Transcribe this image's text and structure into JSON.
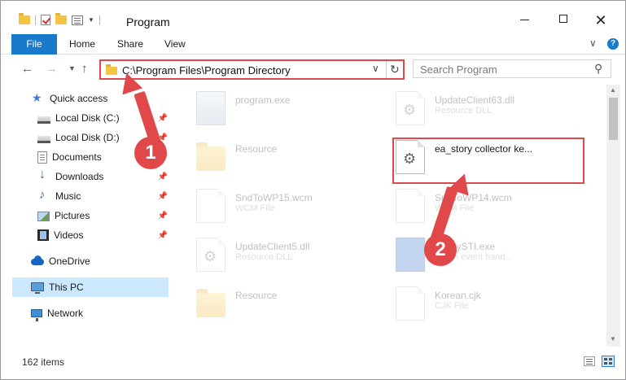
{
  "window": {
    "title": "Program",
    "controls": {
      "minimize": "minimize",
      "maximize": "maximize",
      "close": "✕"
    }
  },
  "ribbon": {
    "tabs": [
      "File",
      "Home",
      "Share",
      "View"
    ],
    "active_tab": "File",
    "accent": "#1979ca"
  },
  "address": {
    "path": "C:\\Program Files\\Program Directory",
    "search_placeholder": "Search Program"
  },
  "sidebar": {
    "items": [
      {
        "label": "Quick access",
        "icon": "star-icon",
        "pinned": false
      },
      {
        "label": "Local Disk (C:)",
        "icon": "drive-icon",
        "pinned": true
      },
      {
        "label": "Local Disk (D:)",
        "icon": "drive-icon",
        "pinned": true
      },
      {
        "label": "Documents",
        "icon": "documents-icon",
        "pinned": true
      },
      {
        "label": "Downloads",
        "icon": "download-icon",
        "pinned": true
      },
      {
        "label": "Music",
        "icon": "music-icon",
        "pinned": true
      },
      {
        "label": "Pictures",
        "icon": "pictures-icon",
        "pinned": true
      },
      {
        "label": "Videos",
        "icon": "videos-icon",
        "pinned": true
      },
      {
        "label": "OneDrive",
        "icon": "cloud-icon",
        "pinned": false
      },
      {
        "label": "This PC",
        "icon": "computer-icon",
        "pinned": false,
        "selected": true
      },
      {
        "label": "Network",
        "icon": "network-icon",
        "pinned": false
      }
    ]
  },
  "files": [
    {
      "name": "program.exe",
      "type": "",
      "icon": "exe-icon",
      "faded": true
    },
    {
      "name": "UpdateClient63.dll",
      "type": "Resource DLL",
      "icon": "dll-icon",
      "faded": true
    },
    {
      "name": "Resource",
      "type": "",
      "icon": "folder-icon",
      "faded": true
    },
    {
      "name": "ea_story collector ke...",
      "type": "",
      "icon": "gear-file-icon",
      "faded": false,
      "highlighted": true
    },
    {
      "name": "SndToWP15.wcm",
      "type": "WCM File",
      "icon": "file-icon",
      "faded": true
    },
    {
      "name": "SndToWP14.wcm",
      "type": "WCM File",
      "icon": "file-icon",
      "faded": true
    },
    {
      "name": "UpdateClient5.dll",
      "type": "Resource DLL",
      "icon": "dll-icon",
      "faded": true
    },
    {
      "name": "EasyySTI.exe",
      "type": "HT sh event hand...",
      "icon": "exe-icon",
      "faded": true
    },
    {
      "name": "Resource",
      "type": "",
      "icon": "folder-icon",
      "faded": true
    },
    {
      "name": "Korean.cjk",
      "type": "CJK File",
      "icon": "file-icon",
      "faded": true
    }
  ],
  "status": {
    "item_count": "162 items"
  },
  "annotations": {
    "step1": "1",
    "step2": "2",
    "color": "#e0484a"
  }
}
